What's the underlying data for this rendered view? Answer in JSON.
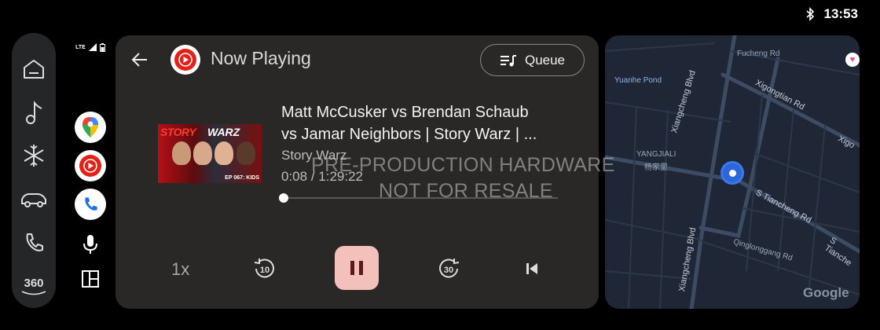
{
  "status": {
    "time": "13:53",
    "network": "LTE"
  },
  "rail": {
    "items": [
      {
        "name": "home-icon"
      },
      {
        "name": "music-note-icon"
      },
      {
        "name": "climate-icon"
      },
      {
        "name": "car-icon"
      },
      {
        "name": "phone-icon"
      },
      {
        "name": "360-camera-icon",
        "label": "360"
      }
    ]
  },
  "apps": [
    {
      "name": "google-maps-icon"
    },
    {
      "name": "youtube-music-icon"
    },
    {
      "name": "phone-app-icon"
    }
  ],
  "now_playing": {
    "header_title": "Now Playing",
    "queue_label": "Queue",
    "track_line1": "Matt McCusker vs Brendan Schaub",
    "track_line2": "vs Jamar Neighbors | Story Warz | ...",
    "artist": "Story Warz",
    "time_current": "0:08",
    "time_sep": " / ",
    "time_total": "1:29:22",
    "progress_fraction": 0.0015,
    "speed": "1x",
    "skip_back_seconds": "10",
    "skip_forward_seconds": "30",
    "artwork": {
      "brand_red": "STORY",
      "brand_white": "WARZ",
      "episode": "EP 067: KIDS"
    }
  },
  "watermark": {
    "line1": "PRE-PRODUCTION HARDWARE",
    "line2": "NOT FOR RESALE"
  },
  "map": {
    "labels": {
      "fucheng": "Fucheng Rd",
      "yuanhe": "Yuanhe Pond",
      "xigongtian": "Xigongtian Rd",
      "xiangcheng1": "Xiangcheng Blvd",
      "yangjiali": "YANGJIALI",
      "yangjiali_cn": "杨家里",
      "stiancheng": "S Tiancheng Rd",
      "qinglonggang": "Qinglonggang Rd",
      "xiangcheng2": "Xiangcheng Blvd",
      "xigo": "Xigo",
      "stianche": "S Tianche",
      "google": "Google"
    }
  },
  "colors": {
    "accent_pause": "#f3c0bc",
    "ytm_red": "#e52117",
    "map_bg": "#1f2736",
    "location_blue": "#2c66d8"
  }
}
